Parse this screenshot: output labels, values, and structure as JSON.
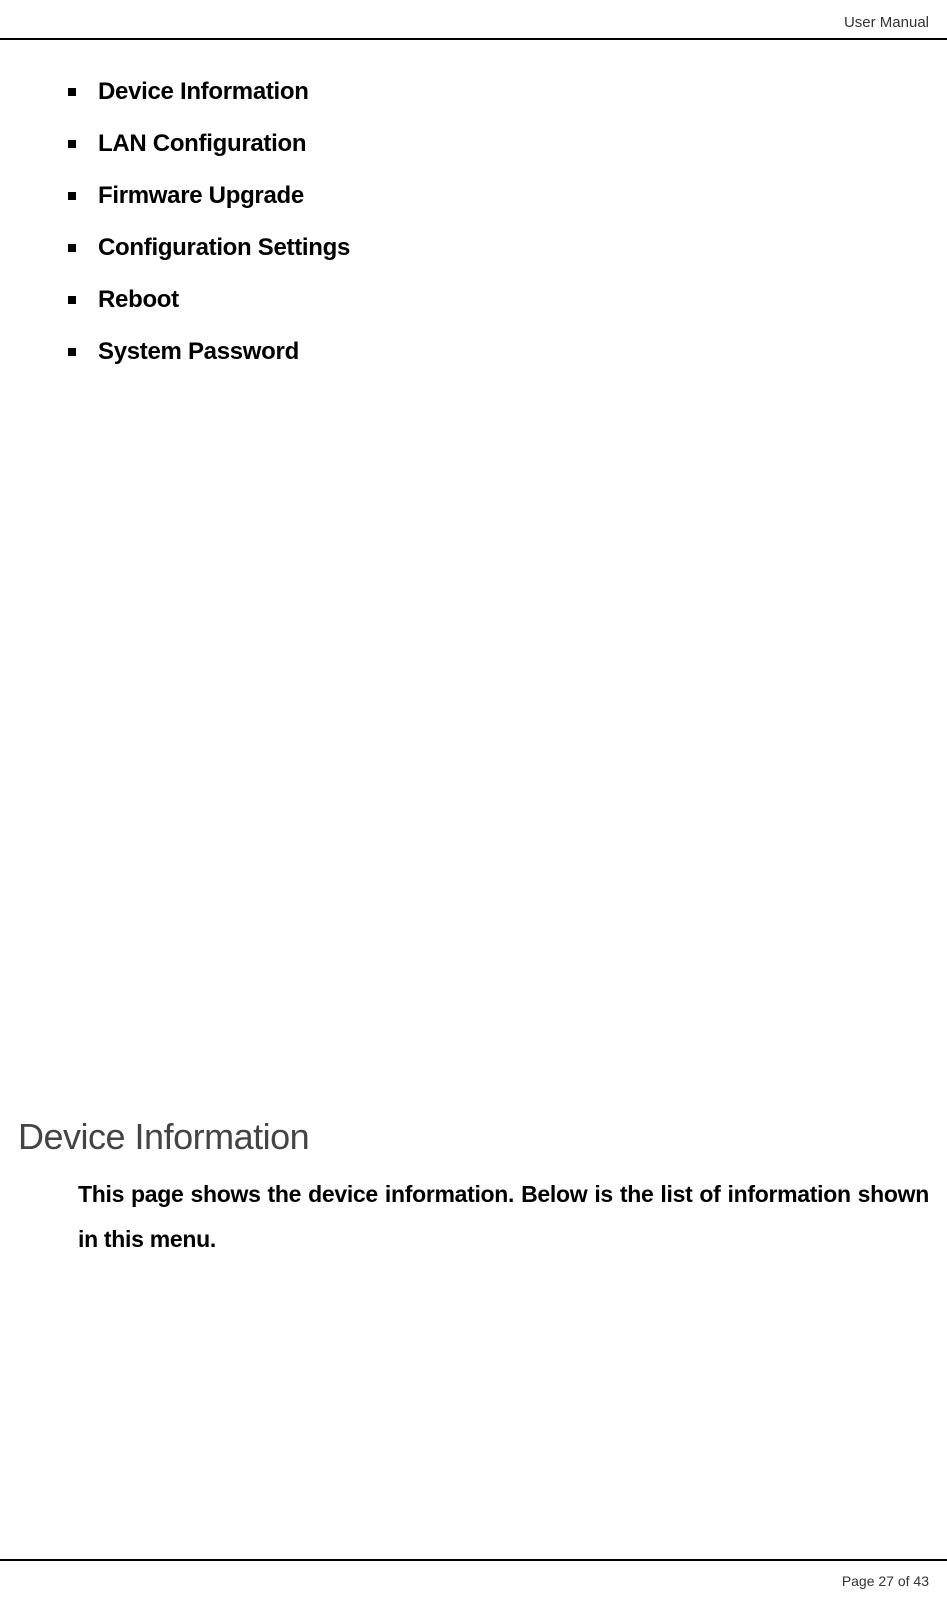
{
  "header": {
    "title": "User Manual"
  },
  "bullets": {
    "items": [
      {
        "label": "Device Information"
      },
      {
        "label": "LAN Configuration"
      },
      {
        "label": "Firmware Upgrade"
      },
      {
        "label": "Configuration Settings"
      },
      {
        "label": "Reboot"
      },
      {
        "label": "System Password"
      }
    ]
  },
  "section": {
    "heading": "Device Information",
    "body": "This page shows the device information. Below is the list of information shown in this menu."
  },
  "footer": {
    "text": "Page 27 of 43"
  }
}
